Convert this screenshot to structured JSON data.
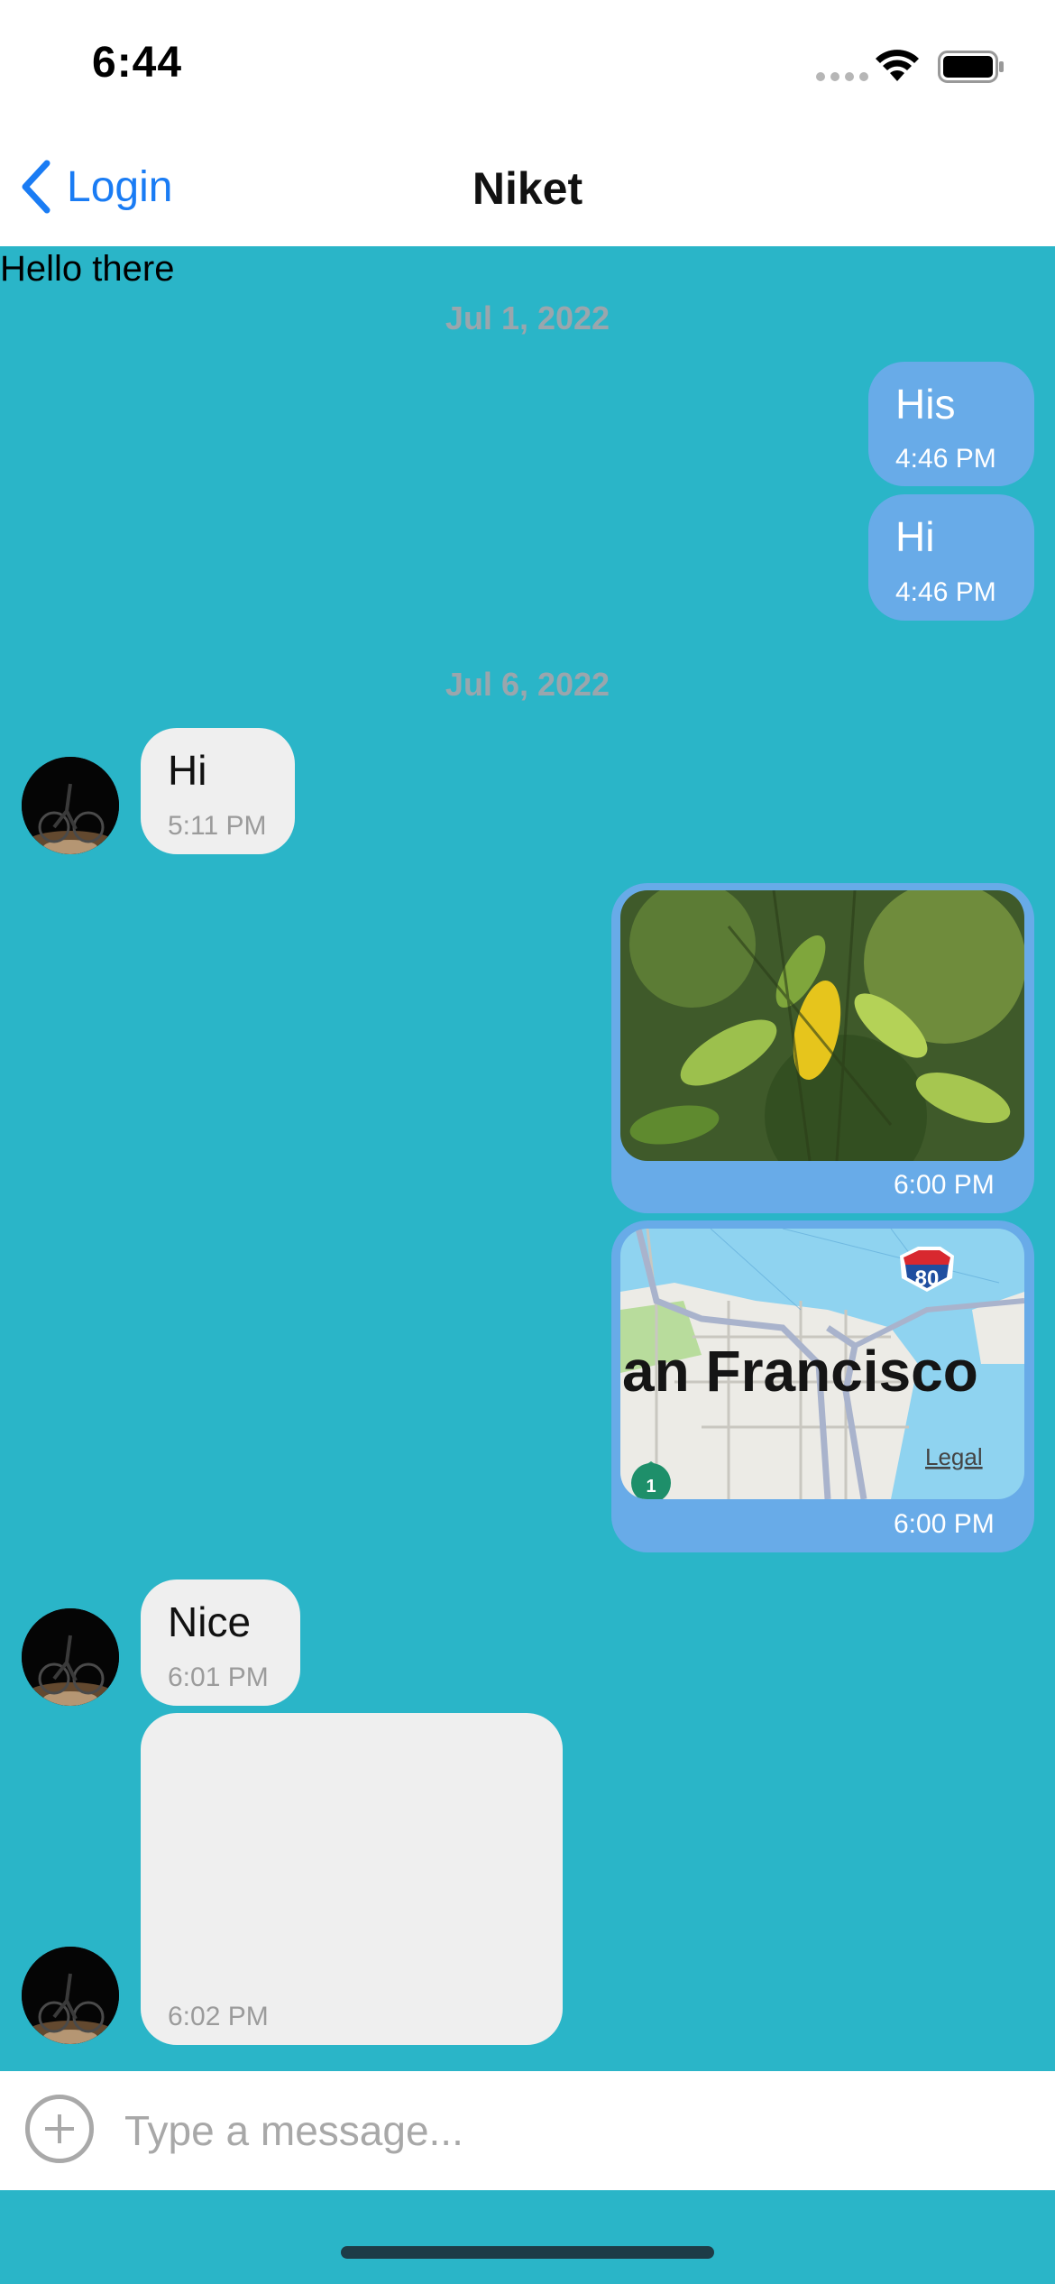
{
  "status_bar": {
    "time": "6:44"
  },
  "nav": {
    "back_label": "Login",
    "title": "Niket"
  },
  "chat": {
    "header_text": "Hello there",
    "date_1": "Jul 1, 2022",
    "date_2": "Jul 6, 2022",
    "msg1": {
      "text": "His",
      "time": "4:46 PM"
    },
    "msg2": {
      "text": "Hi",
      "time": "4:46 PM"
    },
    "msg3": {
      "text": "Hi",
      "time": "5:11 PM"
    },
    "msg4": {
      "time": "6:00 PM"
    },
    "msg5": {
      "time": "6:00 PM",
      "map_label": "an Francisco",
      "legal_label": "Legal",
      "route_1": "1",
      "route_80": "80"
    },
    "msg6": {
      "text": "Nice",
      "time": "6:01 PM"
    },
    "msg7": {
      "time": "6:02 PM"
    }
  },
  "composer": {
    "placeholder": "Type a message..."
  },
  "colors": {
    "background": "#2AB5C8",
    "outgoing": "#68ABE8",
    "incoming": "#EFEFEF",
    "accent": "#1a7cf4"
  }
}
